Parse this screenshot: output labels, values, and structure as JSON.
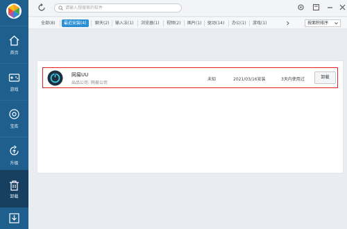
{
  "sidebar": {
    "items": [
      {
        "label": "首页",
        "icon": "home-icon"
      },
      {
        "label": "游戏",
        "icon": "gamepad-icon"
      },
      {
        "label": "宝库",
        "icon": "treasure-icon"
      },
      {
        "label": "升级",
        "icon": "upgrade-icon"
      },
      {
        "label": "卸载",
        "icon": "trash-icon"
      },
      {
        "label": "",
        "icon": "download-icon"
      }
    ]
  },
  "search": {
    "placeholder": "请输入想搜索的软件"
  },
  "tabs": [
    "全部(8)",
    "最近安装(4)",
    "聊天(2)",
    "输入法(1)",
    "浏览器(1)",
    "视频(2)",
    "图片(1)",
    "驱动(14)",
    "办公(1)",
    "游戏(1)"
  ],
  "sort": {
    "label": "按面积排序"
  },
  "apps": [
    {
      "name": "网易UU",
      "publisher": "出品公司: 网易公司",
      "size": "未知",
      "install_date": "2021/03/16安装",
      "usage": "3天内使用过",
      "action": "卸载"
    }
  ],
  "colors": {
    "sidebar": "#1e5f8e",
    "sidebar_active": "#173f5f",
    "tab_active": "#2b8fd4",
    "highlight": "#e02020"
  }
}
